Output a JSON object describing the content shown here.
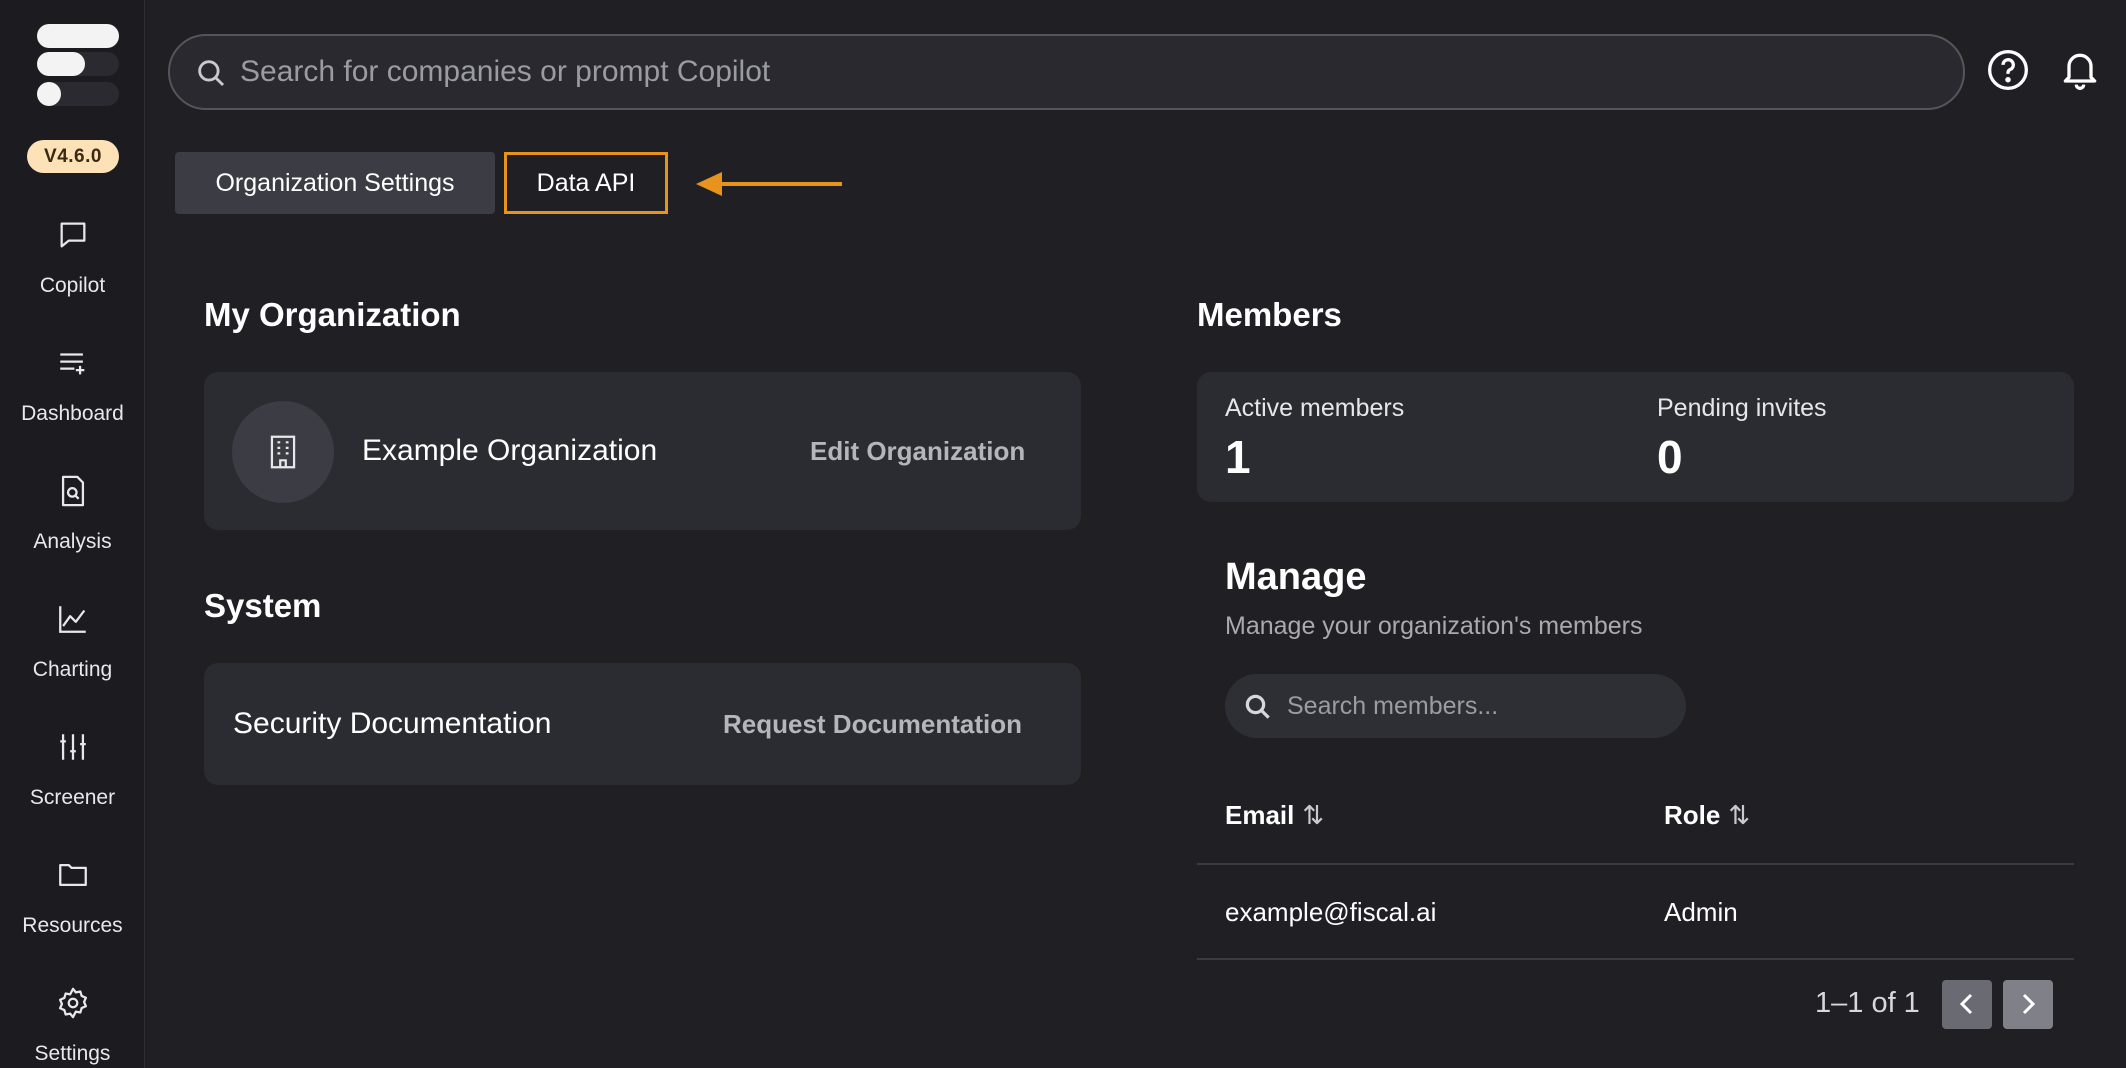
{
  "sidebar": {
    "version": "V4.6.0",
    "items": [
      {
        "label": "Copilot",
        "icon": "chat-bubble-icon"
      },
      {
        "label": "Dashboard",
        "icon": "list-add-icon"
      },
      {
        "label": "Analysis",
        "icon": "document-search-icon"
      },
      {
        "label": "Charting",
        "icon": "line-chart-icon"
      },
      {
        "label": "Screener",
        "icon": "sliders-icon"
      },
      {
        "label": "Resources",
        "icon": "folder-icon"
      },
      {
        "label": "Settings",
        "icon": "gear-icon"
      }
    ]
  },
  "header": {
    "search_placeholder": "Search for companies or prompt Copilot",
    "help_icon": "help-circle-icon",
    "notification_icon": "bell-icon"
  },
  "tabs": [
    {
      "label": "Organization Settings"
    },
    {
      "label": "Data API"
    }
  ],
  "colors": {
    "accent": "#e8931e",
    "version_badge": "#fde1b7",
    "background": "#1f1f24",
    "card": "#2b2b32"
  },
  "my_org": {
    "title": "My Organization",
    "name": "Example Organization",
    "edit_label": "Edit Organization",
    "icon": "building-icon"
  },
  "system": {
    "title": "System",
    "item_label": "Security Documentation",
    "request_label": "Request Documentation"
  },
  "members": {
    "title": "Members",
    "active_label": "Active members",
    "active_value": "1",
    "pending_label": "Pending invites",
    "pending_value": "0"
  },
  "manage": {
    "title": "Manage",
    "subtitle": "Manage your organization's members",
    "search_placeholder": "Search members...",
    "columns": [
      "Email",
      "Role"
    ],
    "rows": [
      {
        "email": "example@fiscal.ai",
        "role": "Admin"
      }
    ],
    "pagination": "1–1 of 1"
  }
}
